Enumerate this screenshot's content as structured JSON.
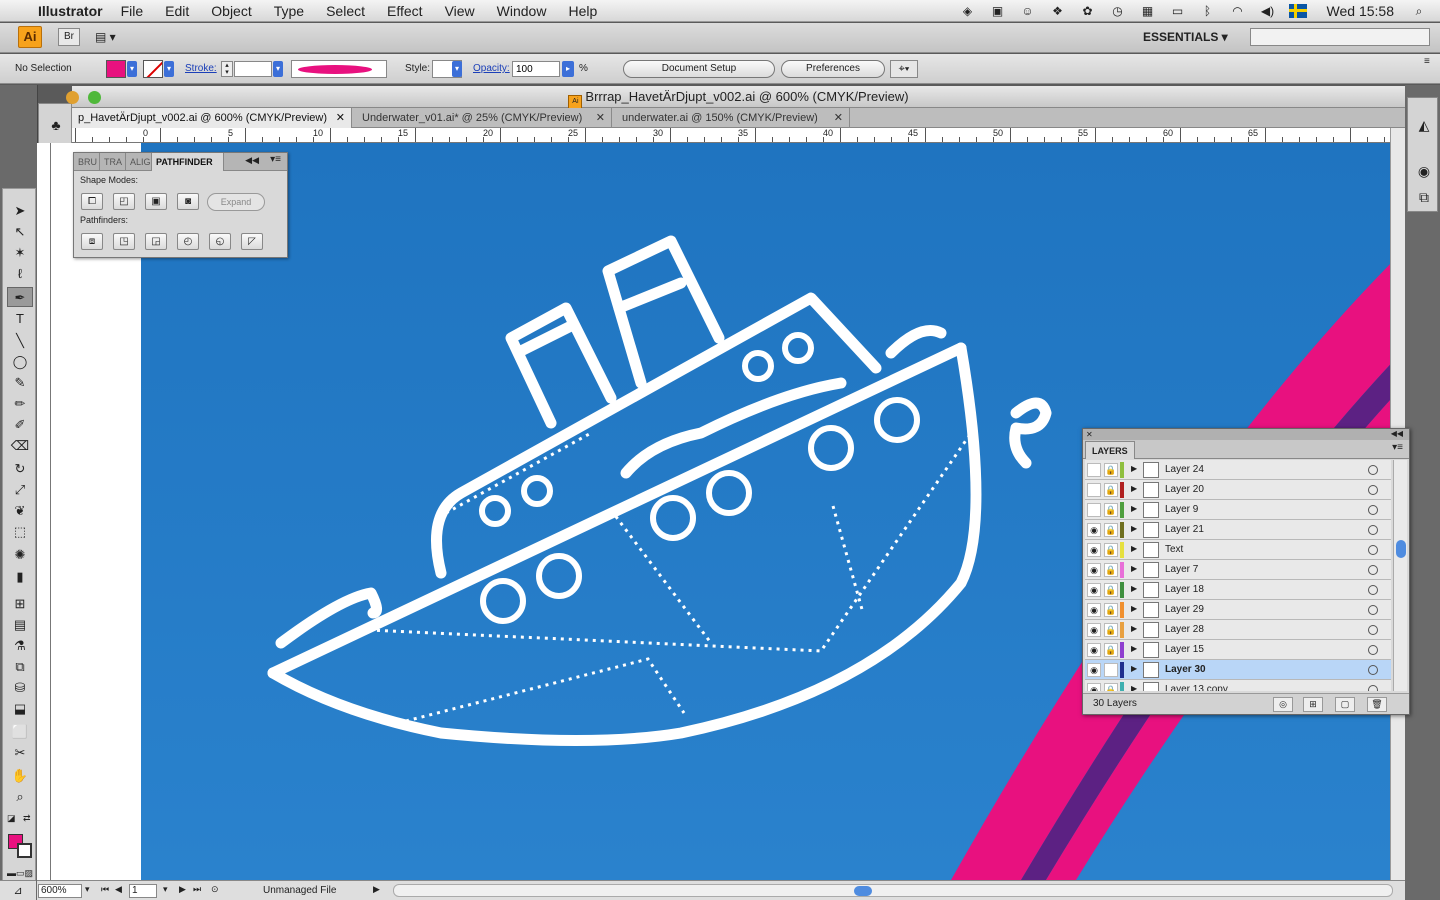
{
  "menubar": {
    "apple": "",
    "app_name": "Illustrator",
    "menus": [
      "File",
      "Edit",
      "Object",
      "Type",
      "Select",
      "Effect",
      "View",
      "Window",
      "Help"
    ],
    "clock": "Wed 15:58",
    "status_icons": [
      "spotlight-icon",
      "wifi-icon",
      "volume-icon",
      "bluetooth-icon",
      "flag-sweden-icon"
    ]
  },
  "appbar": {
    "ai_logo": "Ai",
    "bridge": "Br",
    "arrange": "▤ ▾",
    "workspace": "ESSENTIALS ▾",
    "search_placeholder": ""
  },
  "controlbar": {
    "selection": "No Selection",
    "stroke_label": "Stroke:",
    "style_label": "Style:",
    "opacity_label": "Opacity:",
    "opacity_value": "100",
    "percent": "%",
    "doc_setup": "Document Setup",
    "preferences": "Preferences",
    "fill_color": "#e8117f"
  },
  "document": {
    "title": "Brrrap_HavetÄrDjupt_v002.ai @ 600% (CMYK/Preview)",
    "tabs": [
      {
        "label": "p_HavetÄrDjupt_v002.ai @ 600% (CMYK/Preview)",
        "close": "✕"
      },
      {
        "label": "Underwater_v01.ai* @ 25% (CMYK/Preview)",
        "close": "✕"
      },
      {
        "label": "underwater.ai @ 150% (CMYK/Preview)",
        "close": "✕"
      }
    ],
    "ruler_numbers": [
      "0",
      "5",
      "10",
      "15",
      "20",
      "25",
      "30",
      "35",
      "40",
      "45",
      "50",
      "55",
      "60",
      "65"
    ],
    "zoom": "600%",
    "page": "1",
    "file_status": "Unmanaged File"
  },
  "pathfinder": {
    "tabs": [
      "BRU",
      "TRA",
      "ALIG",
      "PATHFINDER"
    ],
    "shape_modes_label": "Shape Modes:",
    "pathfinders_label": "Pathfinders:",
    "expand": "Expand"
  },
  "layers": {
    "tab": "LAYERS",
    "count": "30 Layers",
    "rows": [
      {
        "name": "Layer 24",
        "visible": false,
        "locked": true,
        "color": "#8fbf3f",
        "selected": false
      },
      {
        "name": "Layer 20",
        "visible": false,
        "locked": true,
        "color": "#b02020",
        "selected": false
      },
      {
        "name": "Layer 9",
        "visible": false,
        "locked": true,
        "color": "#4f9f3f",
        "selected": false
      },
      {
        "name": "Layer 21",
        "visible": true,
        "locked": true,
        "color": "#6f6f1f",
        "selected": false
      },
      {
        "name": "Text",
        "visible": true,
        "locked": true,
        "color": "#e6e03f",
        "selected": false
      },
      {
        "name": "Layer 7",
        "visible": true,
        "locked": true,
        "color": "#e86fd8",
        "selected": false
      },
      {
        "name": "Layer 18",
        "visible": true,
        "locked": true,
        "color": "#3f8f3f",
        "selected": false
      },
      {
        "name": "Layer 29",
        "visible": true,
        "locked": true,
        "color": "#f0902f",
        "selected": false
      },
      {
        "name": "Layer 28",
        "visible": true,
        "locked": true,
        "color": "#e8a040",
        "selected": false
      },
      {
        "name": "Layer 15",
        "visible": true,
        "locked": true,
        "color": "#8f3fcf",
        "selected": false
      },
      {
        "name": "Layer 30",
        "visible": true,
        "locked": false,
        "color": "#1f2f8f",
        "selected": true
      },
      {
        "name": "Layer 13 copy",
        "visible": true,
        "locked": true,
        "color": "#3fafaf",
        "selected": false
      }
    ]
  }
}
